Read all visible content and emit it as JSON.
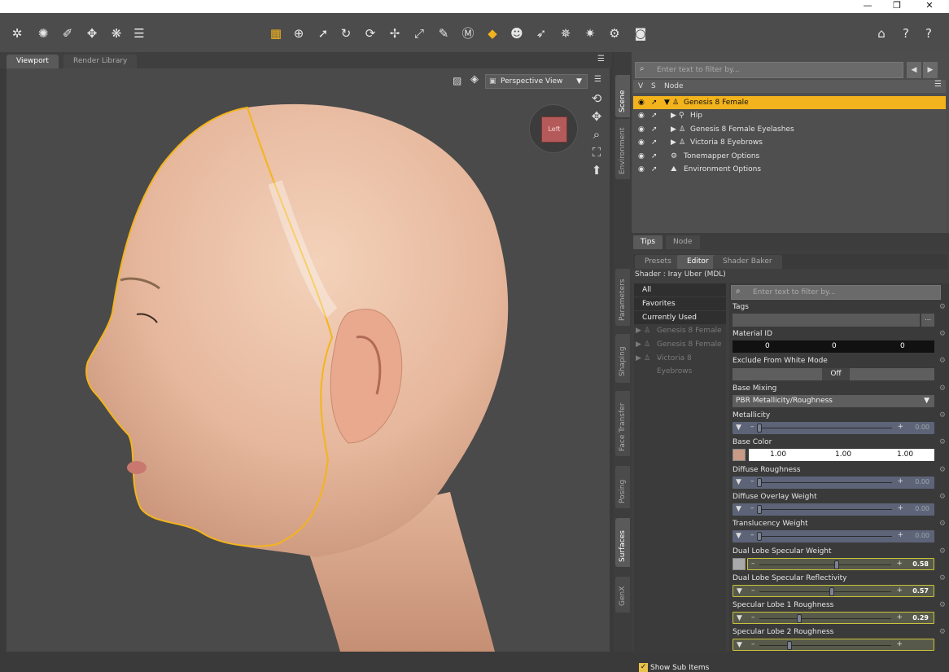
{
  "window": {
    "minimize": "—",
    "maximize": "❐",
    "close": "✕"
  },
  "toolbar": {
    "icons": [
      "snap-icon",
      "joint-editor-icon",
      "universal-icon",
      "node-selection-icon",
      "surface-selection-icon",
      "region-icon",
      "grid-icon",
      "node-tool-icon",
      "pointer-icon",
      "rotate-icon",
      "twist-icon",
      "translate-icon",
      "scale-icon",
      "joint-icon",
      "geometry-icon",
      "morph-icon",
      "face-icon",
      "select-icon",
      "transform-icon",
      "light-icon",
      "render-settings-icon",
      "render-icon",
      "ds-home-icon",
      "help-icon"
    ]
  },
  "viewport_tabs": {
    "viewport": "Viewport",
    "render_library": "Render Library"
  },
  "viewport": {
    "camera": "Perspective View",
    "cube_face": "Left"
  },
  "scene": {
    "filter_placeholder": "Enter text to filter by...",
    "columns": {
      "v": "V",
      "s": "S",
      "node": "Node"
    },
    "nodes": [
      {
        "label": "Genesis 8 Female",
        "selected": true,
        "expanded": true
      },
      {
        "label": "Hip"
      },
      {
        "label": "Genesis 8 Female Eyelashes"
      },
      {
        "label": "Victoria 8 Eyebrows"
      },
      {
        "label": "Tonemapper Options"
      },
      {
        "label": "Environment Options"
      }
    ]
  },
  "side_tabs": {
    "scene": "Scene",
    "environment": "Environment",
    "parameters": "Parameters",
    "shaping": "Shaping",
    "face_transfer": "Face Transfer",
    "posing": "Posing",
    "surfaces": "Surfaces",
    "genx": "GenX"
  },
  "tips_tabs": {
    "tips": "Tips",
    "node": "Node"
  },
  "editor_tabs": {
    "presets": "Presets",
    "editor": "Editor",
    "shader_baker": "Shader Baker"
  },
  "shader": "Shader : Iray Uber (MDL)",
  "material_list": {
    "filters": [
      "All",
      "Favorites",
      "Currently Used"
    ],
    "items": [
      "Genesis 8 Female",
      "Genesis 8 Female ...",
      "Victoria 8 Eyebrows"
    ]
  },
  "props_filter_placeholder": "Enter text to filter by...",
  "props": {
    "tags": "Tags",
    "material_id": {
      "label": "Material ID",
      "values": [
        "0",
        "0",
        "0"
      ]
    },
    "exclude": {
      "label": "Exclude From White Mode",
      "value": "Off"
    },
    "base_mixing": {
      "label": "Base Mixing",
      "value": "PBR Metallicity/Roughness"
    },
    "metallicity": {
      "label": "Metallicity",
      "value": "0.00"
    },
    "base_color": {
      "label": "Base Color",
      "values": [
        "1.00",
        "1.00",
        "1.00"
      ]
    },
    "diffuse_roughness": {
      "label": "Diffuse Roughness",
      "value": "0.00"
    },
    "diffuse_overlay": {
      "label": "Diffuse Overlay Weight",
      "value": "0.00"
    },
    "translucency": {
      "label": "Translucency Weight",
      "value": "0.00"
    },
    "dual_lobe_weight": {
      "label": "Dual Lobe Specular Weight",
      "value": "0.58"
    },
    "dual_lobe_reflectivity": {
      "label": "Dual Lobe Specular Reflectivity",
      "value": "0.57"
    },
    "spec_lobe1": {
      "label": "Specular Lobe 1 Roughness",
      "value": "0.29"
    },
    "spec_lobe2": {
      "label": "Specular Lobe 2 Roughness"
    }
  },
  "show_sub_items": "Show Sub Items",
  "colors": {
    "accent": "#f2b31c",
    "panel": "#3f3f3f"
  }
}
